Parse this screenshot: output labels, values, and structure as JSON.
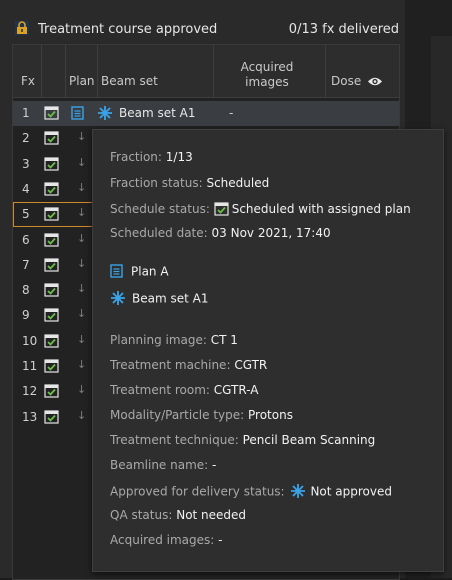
{
  "header": {
    "title": "Treatment course approved",
    "count": "0/13 fx delivered"
  },
  "table": {
    "columns": [
      "Fx",
      "",
      "Plan",
      "Beam set",
      "Acquired images",
      "Dose"
    ],
    "rows": [
      {
        "fx": "1",
        "beam_set": "Beam set A1",
        "acquired": "-"
      },
      {
        "fx": "2"
      },
      {
        "fx": "3"
      },
      {
        "fx": "4"
      },
      {
        "fx": "5"
      },
      {
        "fx": "6"
      },
      {
        "fx": "7"
      },
      {
        "fx": "8"
      },
      {
        "fx": "9"
      },
      {
        "fx": "10"
      },
      {
        "fx": "11"
      },
      {
        "fx": "12"
      },
      {
        "fx": "13"
      }
    ]
  },
  "tooltip": {
    "fraction_label": "Fraction:",
    "fraction_value": "1/13",
    "fraction_status_label": "Fraction status:",
    "fraction_status_value": "Scheduled",
    "schedule_status_label": "Schedule status:",
    "schedule_status_value": "Scheduled with assigned plan",
    "scheduled_date_label": "Scheduled date:",
    "scheduled_date_value": "03 Nov 2021, 17:40",
    "plan_name": "Plan A",
    "beam_set_name": "Beam set A1",
    "planning_image_label": "Planning image:",
    "planning_image_value": "CT 1",
    "treatment_machine_label": "Treatment machine:",
    "treatment_machine_value": "CGTR",
    "treatment_room_label": "Treatment room:",
    "treatment_room_value": "CGTR-A",
    "modality_label": "Modality/Particle type:",
    "modality_value": "Protons",
    "technique_label": "Treatment technique:",
    "technique_value": "Pencil Beam Scanning",
    "beamline_label": "Beamline name:",
    "beamline_value": "-",
    "approved_label": "Approved for delivery status:",
    "approved_value": "Not approved",
    "qa_label": "QA status:",
    "qa_value": "Not needed",
    "acquired_label": "Acquired images:",
    "acquired_value": "-"
  },
  "colors": {
    "background": "#2a2a2a",
    "accent_blue": "#3aa3e8",
    "calendar_green": "#6cc04a",
    "highlight_orange": "#d08a2a"
  },
  "icons": [
    "lock-icon",
    "calendar-check-icon",
    "plan-icon",
    "beam-set-icon",
    "eye-icon",
    "down-arrow-icon"
  ]
}
